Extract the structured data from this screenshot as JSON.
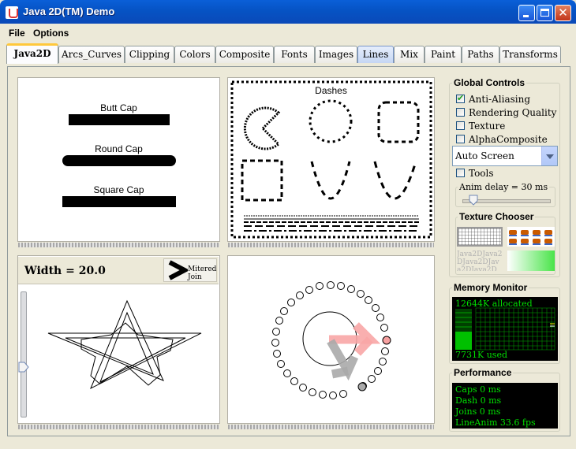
{
  "window": {
    "title": "Java 2D(TM) Demo"
  },
  "menubar": {
    "file": "File",
    "options": "Options"
  },
  "tabs": [
    {
      "label": "Java2D"
    },
    {
      "label": "Arcs_Curves"
    },
    {
      "label": "Clipping"
    },
    {
      "label": "Colors"
    },
    {
      "label": "Composite"
    },
    {
      "label": "Fonts"
    },
    {
      "label": "Images"
    },
    {
      "label": "Lines"
    },
    {
      "label": "Mix"
    },
    {
      "label": "Paint"
    },
    {
      "label": "Paths"
    },
    {
      "label": "Transforms"
    }
  ],
  "selected_tab": "Java2D",
  "caps_demo": {
    "butt": "Butt Cap",
    "round": "Round Cap",
    "square": "Square Cap"
  },
  "dashes_demo": {
    "title": "Dashes"
  },
  "joins_demo": {
    "width_label": "Width = 20.0",
    "join_button": "Mitered Join"
  },
  "global_controls": {
    "title": "Global Controls",
    "anti_aliasing": {
      "label": "Anti-Aliasing",
      "checked": true
    },
    "rendering_quality": {
      "label": "Rendering Quality",
      "checked": false
    },
    "texture": {
      "label": "Texture",
      "checked": false
    },
    "alpha_composite": {
      "label": "AlphaComposite",
      "checked": false
    },
    "screen_combo": "Auto Screen",
    "tools": {
      "label": "Tools",
      "checked": false
    },
    "anim_delay": "Anim delay = 30 ms",
    "texture_chooser": "Texture Chooser",
    "texture_text": "Java2DJava2DJava2DJava2DJava2D"
  },
  "memory_monitor": {
    "title": "Memory Monitor",
    "allocated": "12644K allocated",
    "used": "7731K used"
  },
  "performance": {
    "title": "Performance",
    "lines": [
      "Caps 0 ms",
      "Dash 0 ms",
      "Joins 0 ms",
      "LineAnim 33.6 fps"
    ]
  },
  "colors": {
    "titlebar": "#0a5fd8",
    "console_text": "#00e000",
    "selected_tab_accent": "#ffc83c"
  }
}
